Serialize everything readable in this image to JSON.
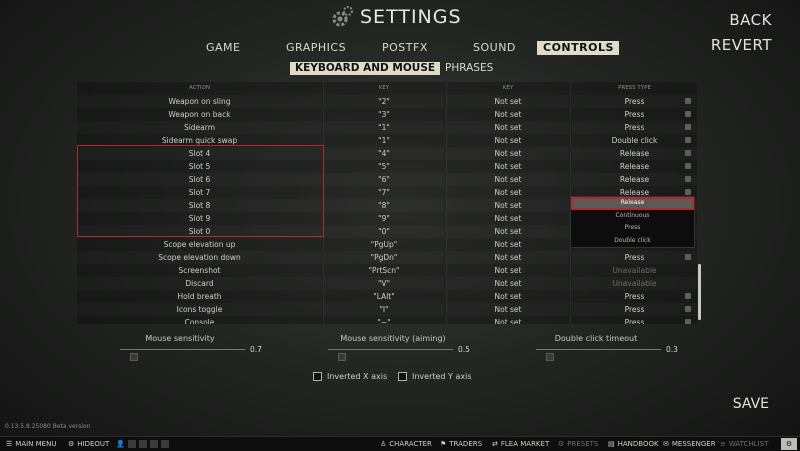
{
  "header": {
    "title": "SETTINGS",
    "back": "BACK",
    "revert": "REVERT",
    "save": "SAVE"
  },
  "tabs": [
    {
      "label": "GAME",
      "active": false
    },
    {
      "label": "GRAPHICS",
      "active": false
    },
    {
      "label": "POSTFX",
      "active": false
    },
    {
      "label": "SOUND",
      "active": false
    },
    {
      "label": "CONTROLS",
      "active": true
    }
  ],
  "subtabs": [
    {
      "label": "KEYBOARD AND MOUSE",
      "active": true
    },
    {
      "label": "PHRASES",
      "active": false
    }
  ],
  "table": {
    "headers": [
      "ACTION",
      "KEY",
      "KEY",
      "PRESS TYPE"
    ],
    "rows": [
      {
        "action": "Weapon on sling",
        "key1": "\"2\"",
        "key2": "Not set",
        "press": "Press"
      },
      {
        "action": "Weapon on back",
        "key1": "\"3\"",
        "key2": "Not set",
        "press": "Press"
      },
      {
        "action": "Sidearm",
        "key1": "\"1\"",
        "key2": "Not set",
        "press": "Press"
      },
      {
        "action": "Sidearm quick swap",
        "key1": "\"1\"",
        "key2": "Not set",
        "press": "Double click"
      },
      {
        "action": "Slot 4",
        "key1": "\"4\"",
        "key2": "Not set",
        "press": "Release"
      },
      {
        "action": "Slot 5",
        "key1": "\"5\"",
        "key2": "Not set",
        "press": "Release"
      },
      {
        "action": "Slot 6",
        "key1": "\"6\"",
        "key2": "Not set",
        "press": "Release"
      },
      {
        "action": "Slot 7",
        "key1": "\"7\"",
        "key2": "Not set",
        "press": "Release"
      },
      {
        "action": "Slot 8",
        "key1": "\"8\"",
        "key2": "Not set",
        "press": ""
      },
      {
        "action": "Slot 9",
        "key1": "\"9\"",
        "key2": "Not set",
        "press": ""
      },
      {
        "action": "Slot 0",
        "key1": "\"0\"",
        "key2": "Not set",
        "press": ""
      },
      {
        "action": "Scope elevation up",
        "key1": "\"PgUp\"",
        "key2": "Not set",
        "press": ""
      },
      {
        "action": "Scope elevation down",
        "key1": "\"PgDn\"",
        "key2": "Not set",
        "press": "Press"
      },
      {
        "action": "Screenshot",
        "key1": "\"PrtScn\"",
        "key2": "Not set",
        "press": "Unavailable"
      },
      {
        "action": "Discard",
        "key1": "\"V\"",
        "key2": "Not set",
        "press": "Unavailable"
      },
      {
        "action": "Hold breath",
        "key1": "\"LAlt\"",
        "key2": "Not set",
        "press": "Press"
      },
      {
        "action": "Icons toggle",
        "key1": "\"I\"",
        "key2": "Not set",
        "press": "Press"
      },
      {
        "action": "Console",
        "key1": "\"~\"",
        "key2": "Not set",
        "press": "Press"
      }
    ]
  },
  "dropdown": {
    "options": [
      "Release",
      "Continuous",
      "Press",
      "Double click"
    ],
    "selected": 0
  },
  "sliders": [
    {
      "label": "Mouse sensitivity",
      "value": "0.7"
    },
    {
      "label": "Mouse sensitivity (aiming)",
      "value": "0.5"
    },
    {
      "label": "Double click timeout",
      "value": "0.3"
    }
  ],
  "checkboxes": [
    {
      "label": "Inverted X axis",
      "checked": false
    },
    {
      "label": "Inverted Y axis",
      "checked": false
    }
  ],
  "version": "0.13.5.8.25080 Beta version",
  "bottombar": {
    "main_menu": "MAIN MENU",
    "hideout": "HIDEOUT",
    "character": "CHARACTER",
    "traders": "TRADERS",
    "flea_market": "FLEA MARKET",
    "presets": "PRESETS",
    "handbook": "HANDBOOK",
    "messenger": "MESSENGER",
    "watchlist": "WATCHLIST"
  }
}
